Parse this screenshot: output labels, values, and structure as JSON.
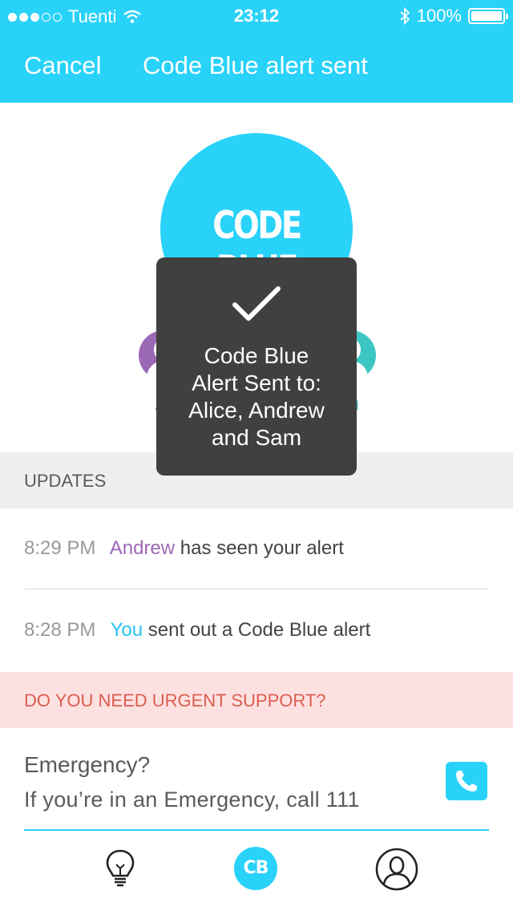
{
  "status_bar": {
    "carrier": "Tuenti",
    "time": "23:12",
    "battery": "100%",
    "signal_bars_filled": 3,
    "signal_bars_total": 5
  },
  "nav": {
    "cancel_label": "Cancel",
    "title": "Code Blue alert sent"
  },
  "hero": {
    "badge_text": "CODE BLUE",
    "contacts": [
      {
        "name": "Alice",
        "visible_text": "Al",
        "color": "#9b68b6"
      },
      {
        "name": "Sam",
        "visible_text": "m",
        "color": "#3cc6c3"
      }
    ]
  },
  "toast": {
    "icon": "checkmark-icon",
    "line1": "Code Blue",
    "line2": "Alert Sent to:",
    "line3": "Alice, Andrew",
    "line4": "and Sam"
  },
  "updates": {
    "header": "UPDATES",
    "items": [
      {
        "time": "8:29 PM",
        "actor": "Andrew",
        "text": "has seen your alert"
      },
      {
        "time": "8:28 PM",
        "actor": "You",
        "text": "sent out a Code Blue alert"
      }
    ]
  },
  "urgent": {
    "header": "DO YOU NEED URGENT SUPPORT?",
    "title": "Emergency?",
    "description": "If you’re in an Emergency, call 111",
    "call_icon": "phone-icon"
  },
  "tab_bar": {
    "items": [
      {
        "icon": "lightbulb-icon"
      },
      {
        "label": "CB"
      },
      {
        "icon": "profile-icon"
      }
    ]
  },
  "colors": {
    "accent": "#29d2f9",
    "andrew": "#9b68b6",
    "you": "#29c3ee",
    "urgent_bg": "#fde1e1",
    "urgent_text": "#dc5c50"
  }
}
